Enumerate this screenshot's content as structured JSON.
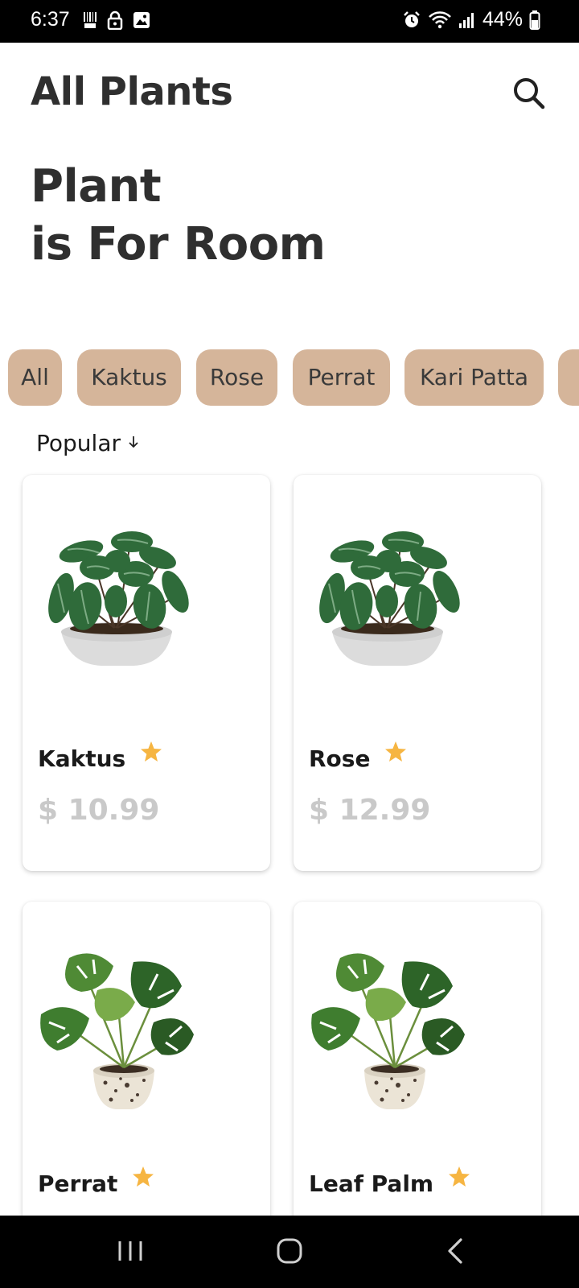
{
  "status_bar": {
    "time": "6:37",
    "battery": "44%",
    "left_icons": [
      "barcode-icon",
      "lock-icon",
      "image-icon"
    ],
    "right_icons": [
      "alarm-icon",
      "wifi-icon",
      "signal-icon",
      "battery-icon"
    ]
  },
  "header": {
    "title": "All Plants",
    "search_icon": "search-icon"
  },
  "headline": {
    "line1": "Plant",
    "line2": "is For Room"
  },
  "categories": [
    "All",
    "Kaktus",
    "Rose",
    "Perrat",
    "Kari Patta"
  ],
  "sort": {
    "label": "Popular",
    "icon": "arrow-down-icon"
  },
  "products": [
    {
      "name": "Kaktus",
      "price": "$ 10.99",
      "image": "peperomia-plant"
    },
    {
      "name": "Rose",
      "price": "$ 12.99",
      "image": "peperomia-plant"
    },
    {
      "name": "Perrat",
      "price": "",
      "image": "monstera-plant"
    },
    {
      "name": "Leaf Palm",
      "price": "",
      "image": "monstera-plant"
    }
  ],
  "colors": {
    "chip_bg": "#d5b59a",
    "star": "#f6b542",
    "price": "#c9c9c9",
    "text": "#2f2f2f"
  },
  "nav_bar": {
    "buttons": [
      "recent-apps-icon",
      "home-icon",
      "back-icon"
    ]
  }
}
